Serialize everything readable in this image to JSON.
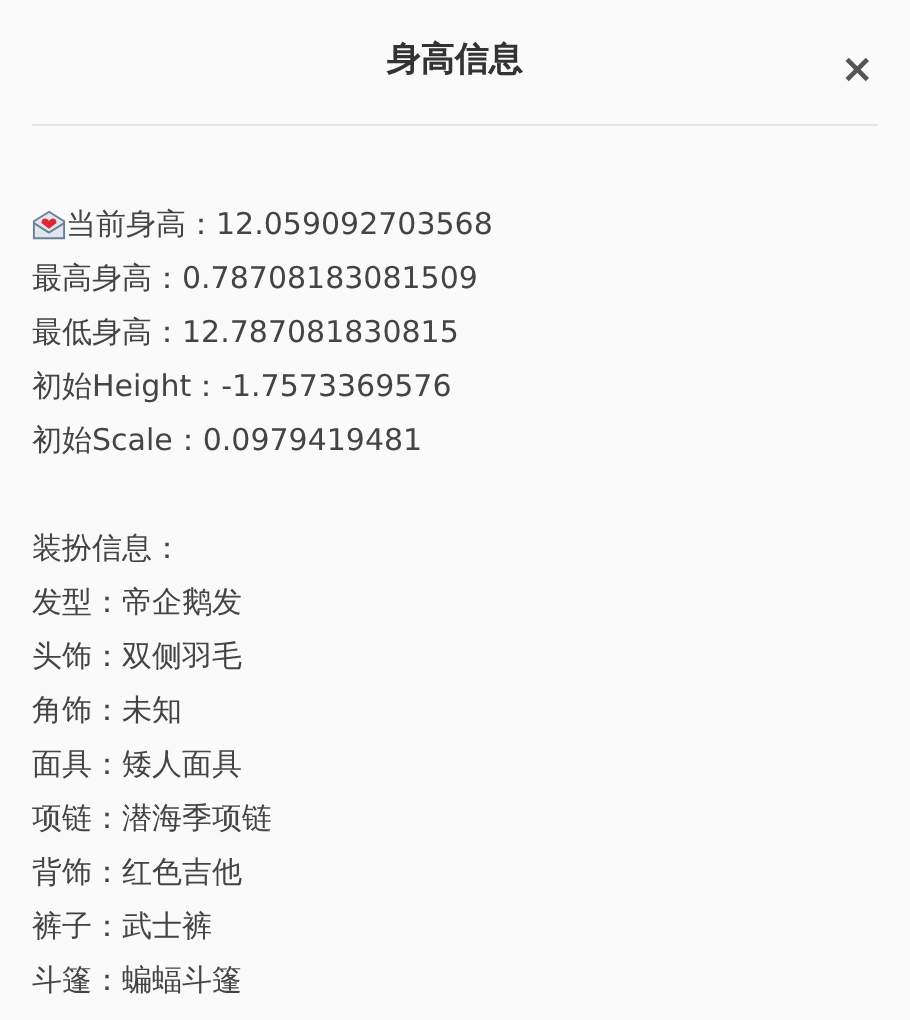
{
  "dialog": {
    "title": "身高信息",
    "close": "×"
  },
  "height_info": [
    {
      "text": "当前身高：12.059092703568",
      "icon": true
    },
    {
      "text": "最高身高：0.78708183081509",
      "icon": false
    },
    {
      "text": "最低身高：12.787081830815",
      "icon": false
    },
    {
      "text": "初始Height：-1.7573369576",
      "icon": false
    },
    {
      "text": "初始Scale：0.0979419481",
      "icon": false
    }
  ],
  "outfit_heading": "装扮信息：",
  "outfit": [
    "发型：帝企鹅发",
    "头饰：双侧羽毛",
    "角饰：未知",
    "面具：矮人面具",
    "项链：潜海季项链",
    "背饰：红色吉他",
    "裤子：武士裤",
    "斗篷：蝙蝠斗篷"
  ]
}
